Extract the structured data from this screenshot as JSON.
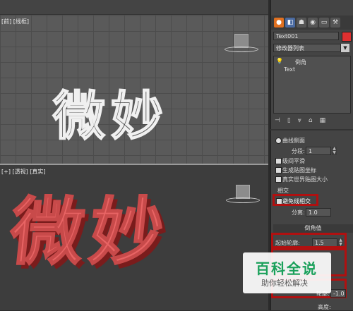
{
  "viewports": {
    "front_label": "[前] [线框]",
    "persp_label": "[+] [透视] [真实]",
    "front_text": "微妙",
    "persp_text": "微妙"
  },
  "panel": {
    "tabs": [
      "create-icon",
      "modify-icon",
      "hierarchy-icon",
      "motion-icon",
      "display-icon",
      "utilities-icon"
    ],
    "object_name": "Text001",
    "object_color": "#e03030",
    "modifier_list": "修改器列表",
    "stack": [
      "倒角",
      "Text"
    ],
    "toolbar_icons": [
      "pin-icon",
      "show-end-icon",
      "make-unique-icon",
      "remove-modifier-icon",
      "configure-icon"
    ],
    "curve_sides_label": "曲线侧面",
    "segments_label": "分段:",
    "segments_value": "1",
    "level_smooth_label": "级间平滑",
    "gen_map_label": "生成贴图坐标",
    "real_world_label": "真实世界贴图大小",
    "intersect_group": "相交",
    "avoid_intersect_label": "避免线相交",
    "separation_label": "分离:",
    "separation_value": "1.0",
    "bevel_values_head": "倒角值",
    "start_outline_label": "起始轮廓:",
    "start_outline_value": "1.5",
    "outline_label": "轮廓:",
    "outline_value": "-1.0",
    "height_label": "高度:"
  },
  "watermark": {
    "main": "百科全说",
    "sub": "助你轻松解决"
  }
}
